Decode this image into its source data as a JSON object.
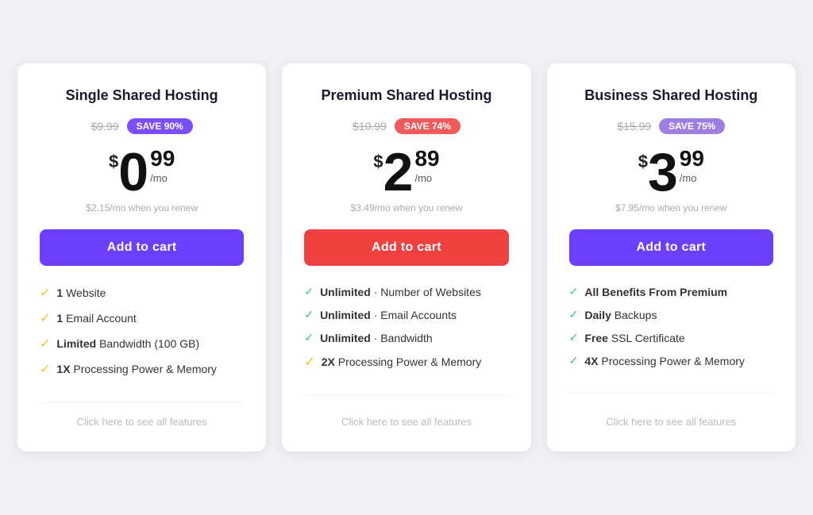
{
  "plans": [
    {
      "id": "single",
      "title": "Single Shared Hosting",
      "original_price": "$9.99",
      "save_label": "SAVE 90%",
      "save_class": "save-purple",
      "price_dollar": "$",
      "price_main": "0",
      "price_cents": "99",
      "price_mo": "/mo",
      "renew_note": "$2.15/mo when you renew",
      "btn_label": "Add to cart",
      "btn_class": "btn-purple",
      "features": [
        {
          "bold": "1",
          "text": " Website",
          "check_class": "check-icon"
        },
        {
          "bold": "1",
          "text": " Email Account",
          "check_class": "check-icon"
        },
        {
          "bold": "Limited",
          "text": " Bandwidth (100 GB)",
          "check_class": "check-icon"
        },
        {
          "bold": "1X",
          "text": " Processing Power & Memory",
          "check_class": "check-icon"
        }
      ],
      "see_all": "Click here to see all features"
    },
    {
      "id": "premium",
      "title": "Premium Shared Hosting",
      "original_price": "$10.99",
      "save_label": "SAVE 74%",
      "save_class": "save-coral",
      "price_dollar": "$",
      "price_main": "2",
      "price_cents": "89",
      "price_mo": "/mo",
      "renew_note": "$3.49/mo when you renew",
      "btn_label": "Add to cart",
      "btn_class": "btn-red",
      "features": [
        {
          "bold": "Unlimited",
          "text": " · Number of Websites",
          "check_class": "check-green"
        },
        {
          "bold": "Unlimited",
          "text": " · Email Accounts",
          "check_class": "check-green"
        },
        {
          "bold": "Unlimited",
          "text": " · Bandwidth",
          "check_class": "check-green"
        },
        {
          "bold": "2X",
          "text": " Processing Power & Memory",
          "check_class": "check-icon"
        }
      ],
      "see_all": "Click here to see all features"
    },
    {
      "id": "business",
      "title": "Business Shared Hosting",
      "original_price": "$15.99",
      "save_label": "SAVE 75%",
      "save_class": "save-lavender",
      "price_dollar": "$",
      "price_main": "3",
      "price_cents": "99",
      "price_mo": "/mo",
      "renew_note": "$7.95/mo when you renew",
      "btn_label": "Add to cart",
      "btn_class": "btn-purple",
      "features": [
        {
          "bold": "All Benefits From Premium",
          "text": "",
          "check_class": "check-green"
        },
        {
          "bold": "Daily",
          "text": " Backups",
          "check_class": "check-green"
        },
        {
          "bold": "Free",
          "text": " SSL Certificate",
          "check_class": "check-green"
        },
        {
          "bold": "4X",
          "text": " Processing Power & Memory",
          "check_class": "check-green"
        }
      ],
      "see_all": "Click here to see all features"
    }
  ]
}
